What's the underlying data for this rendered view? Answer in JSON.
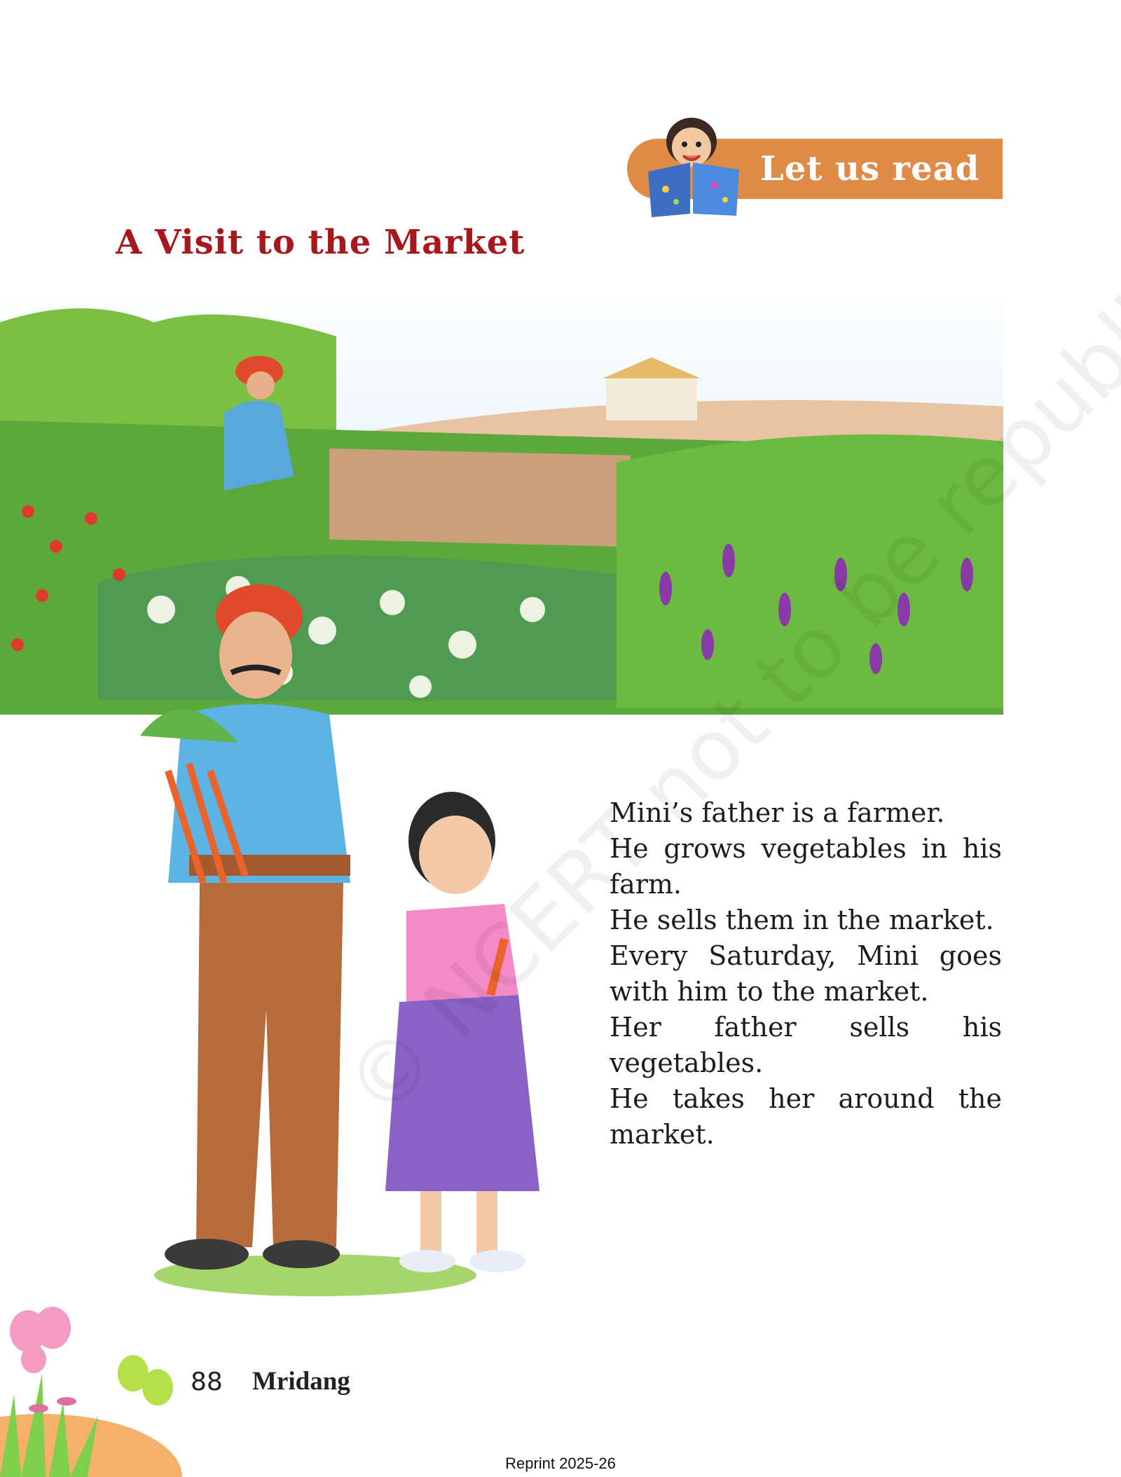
{
  "banner": {
    "label": "Let us read"
  },
  "page_title": "A Visit to the Market",
  "story_lines": [
    "Mini’s father is a farmer.",
    "He grows vegetables in his farm.",
    "He sells them in the market.",
    "Every Saturday, Mini goes with him to the market.",
    "Her father sells his vegetables.",
    "He takes her around the market."
  ],
  "watermark": "© NCERT not to be republished",
  "footer": {
    "page_number": "88",
    "book_name": "Mridang",
    "reprint": "Reprint 2025-26"
  },
  "colors": {
    "banner": "#e08b45",
    "title": "#a8171b",
    "text": "#1d1d1d"
  }
}
